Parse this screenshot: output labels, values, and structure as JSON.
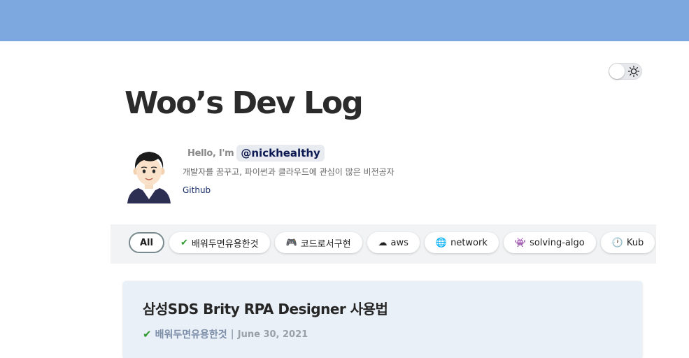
{
  "header": {
    "blog_title": "Woo’s Dev Log"
  },
  "profile": {
    "hello_text": "Hello, I'm",
    "handle": "@nickhealthy",
    "bio": "개발자를 꿈꾸고, 파이썬과 클라우드에 관심이 많은 비전공자",
    "github_label": "Github"
  },
  "categories": [
    {
      "label": "All",
      "icon": "",
      "active": true
    },
    {
      "label": "배워두면유용한것",
      "icon": "check-mark-icon",
      "glyph": "✔"
    },
    {
      "label": "코드로서구현",
      "icon": "game-controller-icon",
      "glyph": "🎮"
    },
    {
      "label": "aws",
      "icon": "cloud-icon",
      "glyph": "☁"
    },
    {
      "label": "network",
      "icon": "globe-icon",
      "glyph": "🌐"
    },
    {
      "label": "solving-algo",
      "icon": "puzzle-icon",
      "glyph": "👾"
    },
    {
      "label": "Kub",
      "icon": "clock-icon",
      "glyph": "🕐"
    }
  ],
  "post": {
    "title": "삼성SDS Brity RPA Designer 사용법",
    "category": "배워두면유용한것",
    "separator": "|",
    "date": "June 30, 2021"
  },
  "colors": {
    "topbar": "#7ca7df",
    "handle_text": "#0d1a52",
    "card_bg": "#eaf0f8"
  }
}
